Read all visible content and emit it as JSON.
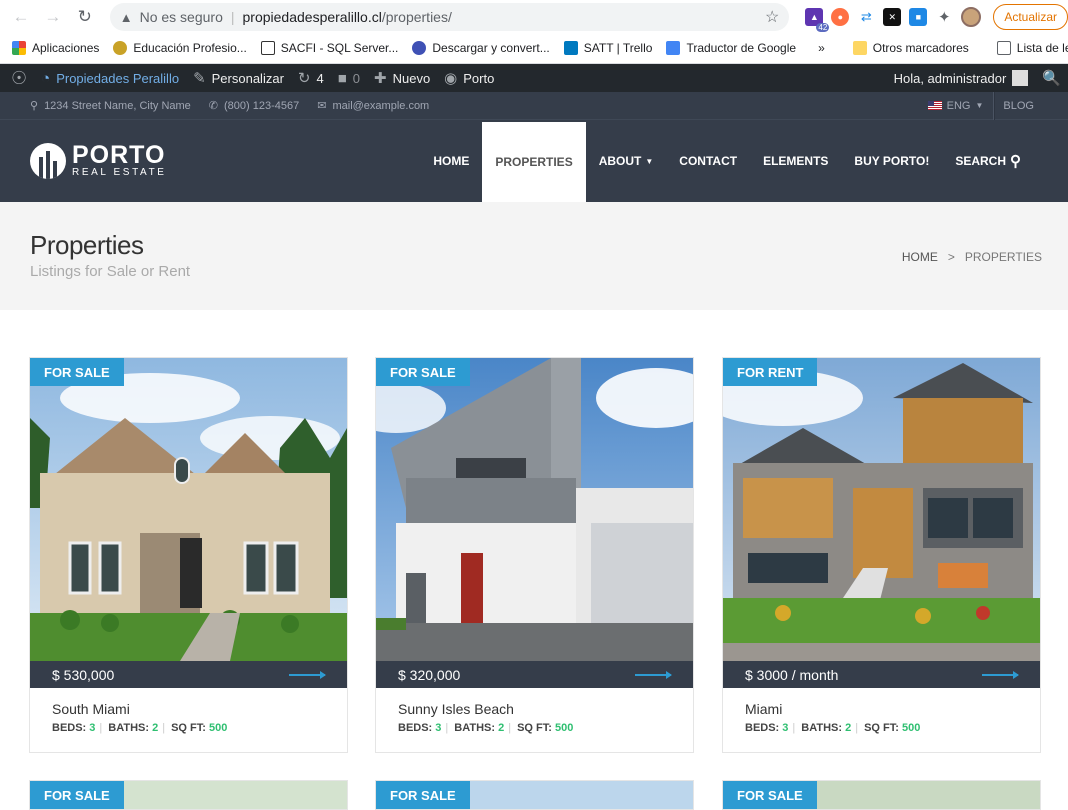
{
  "browser": {
    "url_warning": "No es seguro",
    "url_host": "propiedadesperalillo.cl",
    "url_path": "/properties/",
    "update_label": "Actualizar",
    "ext_badge": "42",
    "bookmarks": [
      "Aplicaciones",
      "Educación Profesio...",
      "SACFI - SQL Server...",
      "Descargar y convert...",
      "SATT | Trello",
      "Traductor de Google"
    ],
    "bookmarks_more": "»",
    "other_bookmarks": "Otros marcadores",
    "reading_list": "Lista de lectura"
  },
  "adminbar": {
    "site": "Propiedades Peralillo",
    "customize": "Personalizar",
    "updates": "4",
    "comments": "0",
    "new": "Nuevo",
    "theme": "Porto",
    "greeting": "Hola, administrador"
  },
  "topinfo": {
    "address": "1234 Street Name, City Name",
    "phone": "(800) 123-4567",
    "email": "mail@example.com",
    "lang": "ENG",
    "blog": "BLOG"
  },
  "logo": {
    "line1": "PORTO",
    "line2": "REAL ESTATE"
  },
  "menu": {
    "home": "HOME",
    "properties": "PROPERTIES",
    "about": "ABOUT",
    "contact": "CONTACT",
    "elements": "ELEMENTS",
    "buy": "BUY PORTO!",
    "search": "SEARCH"
  },
  "page": {
    "title": "Properties",
    "subtitle": "Listings for Sale or Rent",
    "crumb_home": "HOME",
    "crumb_sep": ">",
    "crumb_current": "PROPERTIES"
  },
  "labels": {
    "beds": "BEDS:",
    "baths": "BATHS:",
    "sqft": "SQ FT:"
  },
  "listings": [
    {
      "tag": "FOR SALE",
      "price": "$ 530,000",
      "title": "South Miami",
      "beds": "3",
      "baths": "2",
      "sqft": "500"
    },
    {
      "tag": "FOR SALE",
      "price": "$ 320,000",
      "title": "Sunny Isles Beach",
      "beds": "3",
      "baths": "2",
      "sqft": "500"
    },
    {
      "tag": "FOR RENT",
      "price": "$ 3000 / month",
      "title": "Miami",
      "beds": "3",
      "baths": "2",
      "sqft": "500"
    }
  ],
  "next_row_tags": [
    "FOR SALE",
    "FOR SALE",
    "FOR SALE"
  ],
  "colors": {
    "accent": "#2d9bd2",
    "dark": "#353d4a",
    "green": "#2fbf71"
  }
}
